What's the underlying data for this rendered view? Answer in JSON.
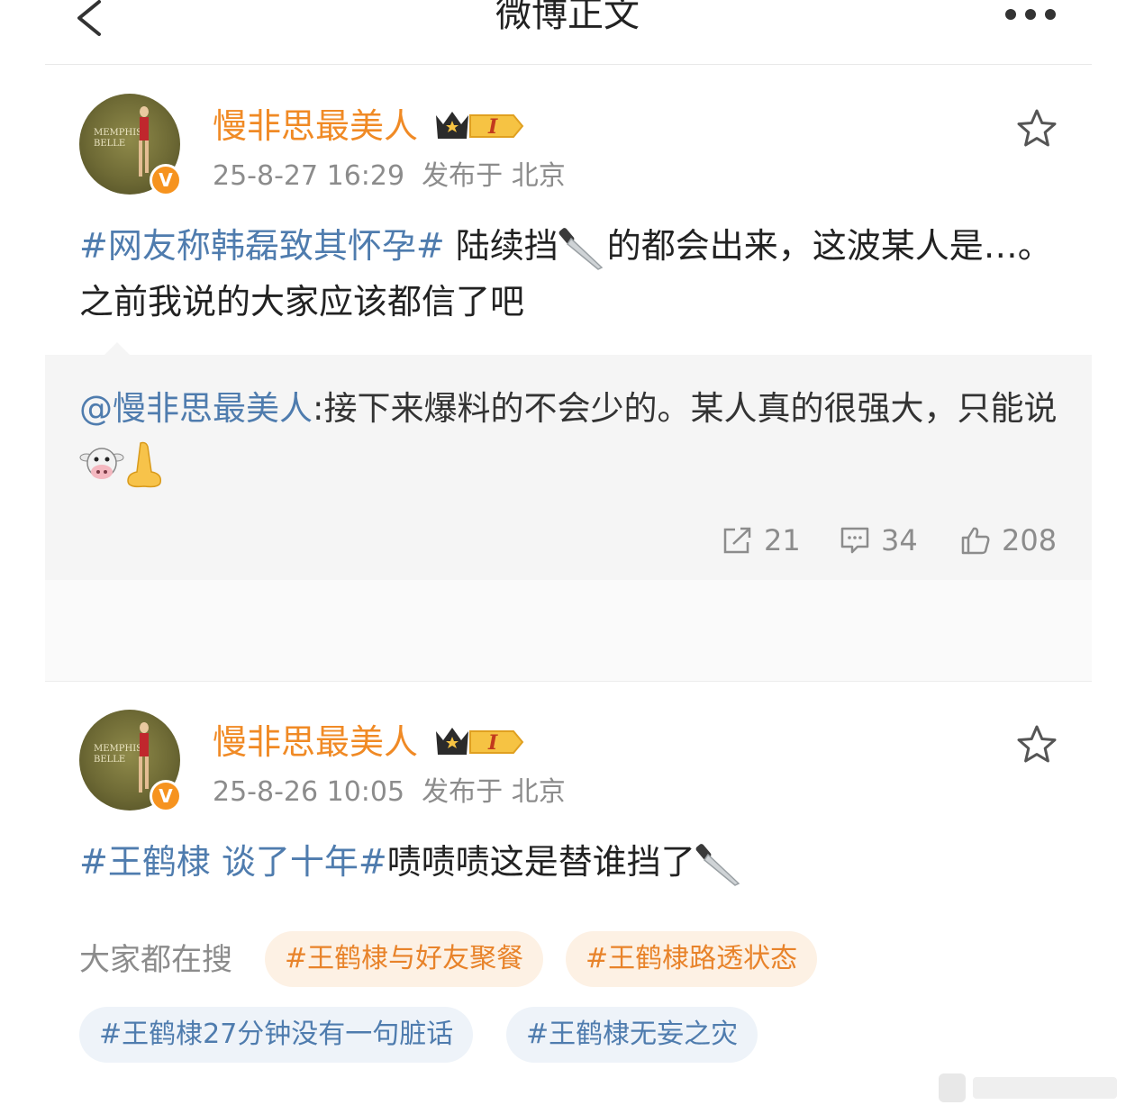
{
  "header": {
    "title": "微博正文",
    "back_icon": "chevron-left-icon",
    "more_icon": "more-dots-icon"
  },
  "post1": {
    "username": "慢非思最美人",
    "avatar_text": "MEMPHIS BELLE",
    "verified": "V",
    "crown_level": "I",
    "timestamp": "25-8-27 16:29",
    "location": "发布于 北京",
    "topic": "#网友称韩磊致其怀孕#",
    "text_a": " 陆续挡",
    "text_b": "的都会出来，这波某人是…。之前我说的大家应该都信了吧",
    "repost": {
      "mention": "@慢非思最美人",
      "text": ":接下来爆料的不会少的。某人真的很强大，只能说"
    },
    "stats": {
      "reposts": "21",
      "comments": "34",
      "likes": "208"
    }
  },
  "post2": {
    "username": "慢非思最美人",
    "avatar_text": "MEMPHIS BELLE",
    "verified": "V",
    "crown_level": "I",
    "timestamp": "25-8-26 10:05",
    "location": "发布于 北京",
    "topic": "#王鹤棣 谈了十年#",
    "text_a": "啧啧啧这是替谁挡了"
  },
  "trending": {
    "label": "大家都在搜",
    "chips": [
      "#王鹤棣与好友聚餐",
      "#王鹤棣路透状态",
      "#王鹤棣27分钟没有一句脏话",
      "#王鹤棣无妄之灾"
    ]
  },
  "colors": {
    "username": "#f08a25",
    "topic": "#4f7cae",
    "meta": "#8c8c8c"
  }
}
